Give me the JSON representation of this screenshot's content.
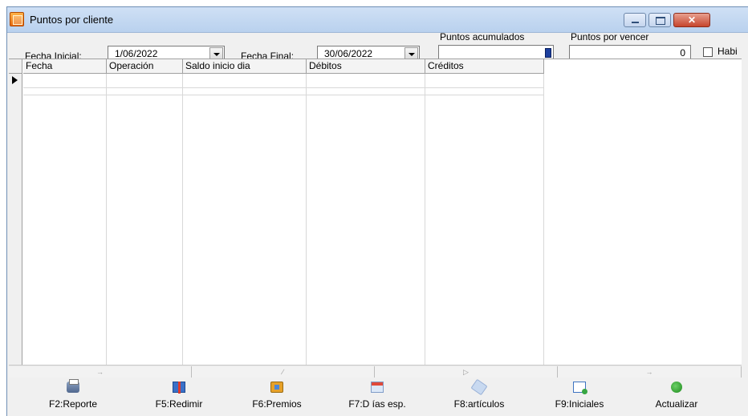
{
  "window": {
    "title": "Puntos por cliente",
    "icon": "app-icon",
    "controls": [
      "minimize-icon",
      "maximize-icon",
      "close-icon"
    ]
  },
  "filters": {
    "fecha_inicial_label": "Fecha Inicial:",
    "fecha_inicial_value": "1/06/2022",
    "fecha_final_label": "Fecha Final:",
    "fecha_final_value": "30/06/2022",
    "puntos_acumulados_label": "Puntos acumulados",
    "puntos_acumulados_value": "",
    "puntos_por_vencer_label": "Puntos por vencer",
    "puntos_por_vencer_value": "0",
    "habilitar_label": "Habi"
  },
  "grid": {
    "columns": [
      "Fecha",
      "Operación",
      "Saldo inicio dia",
      "Débitos",
      "Créditos"
    ],
    "rows": []
  },
  "toolbar": {
    "buttons": [
      {
        "label": "F2:Reporte",
        "icon": "printer-icon"
      },
      {
        "label": "F5:Redimir",
        "icon": "gift-icon"
      },
      {
        "label": "F6:Premios",
        "icon": "award-icon"
      },
      {
        "label": "F7:D ías esp.",
        "icon": "calendar-icon"
      },
      {
        "label": "F8:artículos",
        "icon": "tag-icon"
      },
      {
        "label": "F9:Iniciales",
        "icon": "window-icon"
      },
      {
        "label": "Actualizar",
        "icon": "refresh-icon"
      }
    ]
  },
  "colors": {
    "titlebar": "#b9d1ee",
    "window_bg": "#f0f0f0",
    "close_button": "#c6452d",
    "grid_line": "#d8d8d8"
  }
}
